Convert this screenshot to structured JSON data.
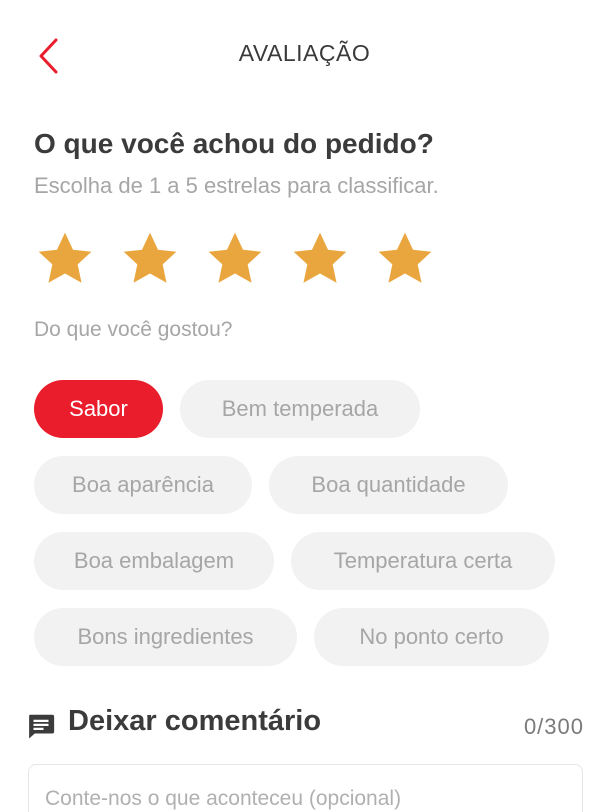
{
  "colors": {
    "accent": "#ea1d2c",
    "star": "#eaa63e",
    "chip_bg": "#f2f2f2",
    "muted_text": "#a6a6a6"
  },
  "header": {
    "back_icon": "chevron-left-icon",
    "title": "AVALIAÇÃO"
  },
  "rating": {
    "question": "O que você achou do pedido?",
    "instruction": "Escolha de 1 a 5 estrelas para classificar.",
    "selected_stars": 5,
    "max_stars": 5
  },
  "liked": {
    "label": "Do que você gostou?",
    "chips": [
      {
        "label": "Sabor",
        "selected": true
      },
      {
        "label": "Bem temperada",
        "selected": false
      },
      {
        "label": "Boa aparência",
        "selected": false
      },
      {
        "label": "Boa quantidade",
        "selected": false
      },
      {
        "label": "Boa embalagem",
        "selected": false
      },
      {
        "label": "Temperatura certa",
        "selected": false
      },
      {
        "label": "Bons ingredientes",
        "selected": false
      },
      {
        "label": "No ponto certo",
        "selected": false
      }
    ]
  },
  "comment": {
    "icon": "comment-icon",
    "title": "Deixar comentário",
    "counter": "0/300",
    "value": "",
    "placeholder": "Conte-nos o que aconteceu (opcional)"
  }
}
